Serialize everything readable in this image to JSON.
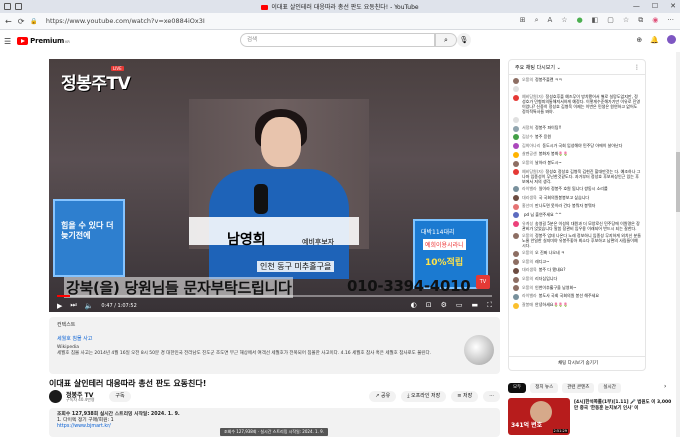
{
  "browser": {
    "tab_title": "이대표 살인테러 대응따라 총선 판도 요동친다! - YouTube",
    "url": "https://www.youtube.com/watch?v=xe0884iOx3I",
    "window_controls": [
      "—",
      "☐",
      "✕"
    ]
  },
  "header": {
    "logo_text": "Premium",
    "logo_region": "KR",
    "search_placeholder": "검색"
  },
  "video": {
    "channel_logo": "정봉주TV",
    "live_label": "LIVE",
    "sign_left_text": "힘을 수 있다 더 늦기전에",
    "sign_right_line1": "대박114대리",
    "sign_right_line2": "예희이용시라니",
    "sign_right_line3": "10%적립",
    "speaker_name": "남영희",
    "speaker_role": "예비후보자",
    "speaker_sub": "인천 동구 미추홀구을",
    "caption_main": "강북(을) 당원님들 문자부탁드립니다",
    "caption_phone": "010-3394-4010",
    "progress": 0.03,
    "time": "0:47 / 1:07:52"
  },
  "info_panel": {
    "header": "컨텍스트",
    "link": "세월호 침몰 사고",
    "source": "Wikipedia",
    "description": "세월호 침몰 사고는 2014년 4월 16일 오전 8시 50분 경 대한민국 전라남도 진도군 조도면 부근 해상에서 여객선 세월호가 전복되어 침몰한 사고이다. 4.16 세월호 참사 혹은 세월호 참사로도 불린다."
  },
  "video_title": "이대표 살인테러 대응따라 총선 판도 요동친다!",
  "owner": {
    "name": "정봉주 TV",
    "subs": "구독자 40.4만명",
    "subscribe": "구독",
    "actions": [
      "공유",
      "오프라인 저장",
      "저장",
      "···"
    ]
  },
  "description": {
    "stats": "조회수 127,938회 실시간 스트리밍 시작일: 2024. 1. 9.",
    "line1": "1. 다이렉 정기 구매/회원: 1",
    "link": "https://www.bjmart.kr/",
    "tooltip": "조회수 127,938회 · 실시간 스트리밍 시작일: 2024. 1. 9."
  },
  "chat": {
    "header": "주요 채팅 다시보기 ⌄",
    "hide_label": "채팅 다시보기 숨기기",
    "messages": [
      {
        "author": "오풍의",
        "text": "정봉주플랜 ㅋㅋ",
        "color": "#8d6e63"
      },
      {
        "author": "",
        "text": "",
        "color": "#e0e0e0"
      },
      {
        "author": "예비당원(자)",
        "text": "정성호후플 예즈무이 방치됐어서 별로 실망도없지만, 정성호가 민형피의통해져서하게 예정다. 이렇게수준해가기만 이유로 진영이었나? 신중히 정성호 김병욱 이제는 이번은 민생은 원연하고 없어도 정치적특사들 봐야.",
        "color": "#e53935"
      },
      {
        "author": "",
        "text": "",
        "color": "#e0e0e0"
      },
      {
        "author": "서정희",
        "text": "정봉주 파이팅!!",
        "color": "#90a4ae"
      },
      {
        "author": "김상수",
        "text": "봉주 응원",
        "color": "#43a047"
      },
      {
        "author": "김희아나리",
        "text": "동도시가 국회 입성해야 민주당 아에이 살아난다",
        "color": "#ab47bc"
      },
      {
        "author": "살펜공샌",
        "text": "봉화자 봉화",
        "emoji": "🌷🌷",
        "color": "#ffb300"
      },
      {
        "author": "오풍의",
        "text": "날아라 봉도시~",
        "color": "#8d6e63"
      },
      {
        "author": "예비당원(자)",
        "text": "정성호 정성호 김병욱 김현진 할대만것는 다. 예조하나 그나마 임종성이 무난한것같도다. 과거부터 정성호 후보비상인근 있는 후보에서 저의 생각.",
        "color": "#e53935"
      },
      {
        "author": "라이밸라",
        "text": "일이라 정봉주 호원 됩니다 쌍동시 소리를",
        "color": "#78909c"
      },
      {
        "author": "대리생육",
        "text": "국 국회의원봉봉보고 싶습니다",
        "color": "#6d4c41"
      },
      {
        "author": "홍선미",
        "text": "만나도면 못이라 건다 봉뭐자 봉뭐자",
        "color": "#e57373"
      },
      {
        "author": "",
        "text": "pd 님 출연주세요 ^^",
        "color": "#5c6bc0"
      },
      {
        "author": "유계성",
        "text": "송영길 5분은 이성의 대원과 더 모양로신 민주당에 이원명은 장관비가 얹었습니다 말씀 장관비 임우용 이래되어 반드시 되는 잘한다.",
        "color": "#ec407a"
      },
      {
        "author": "오풍의",
        "text": "정봉주 업데 나온다 노레 정보하니 임종성 무지하게 외치신 분들 노물 안일한 실지미야 유봉주좋아 최소다 후보하고 남편의 사림들이예시다.",
        "color": "#8d6e63"
      },
      {
        "author": "오풍의",
        "text": "오 진짜 나오네 ㅋ",
        "color": "#8d6e63"
      },
      {
        "author": "오풍의",
        "text": "레디고~",
        "color": "#8d6e63"
      },
      {
        "author": "대리생육",
        "text": "봉주 다 됐내요?",
        "color": "#6d4c41"
      },
      {
        "author": "오풍의",
        "text": "리더심입니다",
        "color": "#8d6e63"
      },
      {
        "author": "오풍의",
        "text": "인천이추홀구을 남영회~",
        "color": "#8d6e63"
      },
      {
        "author": "라이밸라",
        "text": "봉도사 국회 국회의원 봉선 해주세요",
        "color": "#78909c"
      },
      {
        "author": "잘봉매",
        "text": "안녕하세요",
        "emoji": "🌷🌷🌷",
        "color": "#fbc02d"
      }
    ]
  },
  "chips": [
    "모두",
    "정치 뉴스",
    "관련 콘텐츠",
    "실시간"
  ],
  "recommendation": {
    "thumb_text": "341억 변호",
    "duration": "2:51:29",
    "title": "[4시]한석쪽롤(1부)[1.11] 🎤 법원도 이 3,000만 중국 '한동훈 눈치보기 인사' 이"
  }
}
